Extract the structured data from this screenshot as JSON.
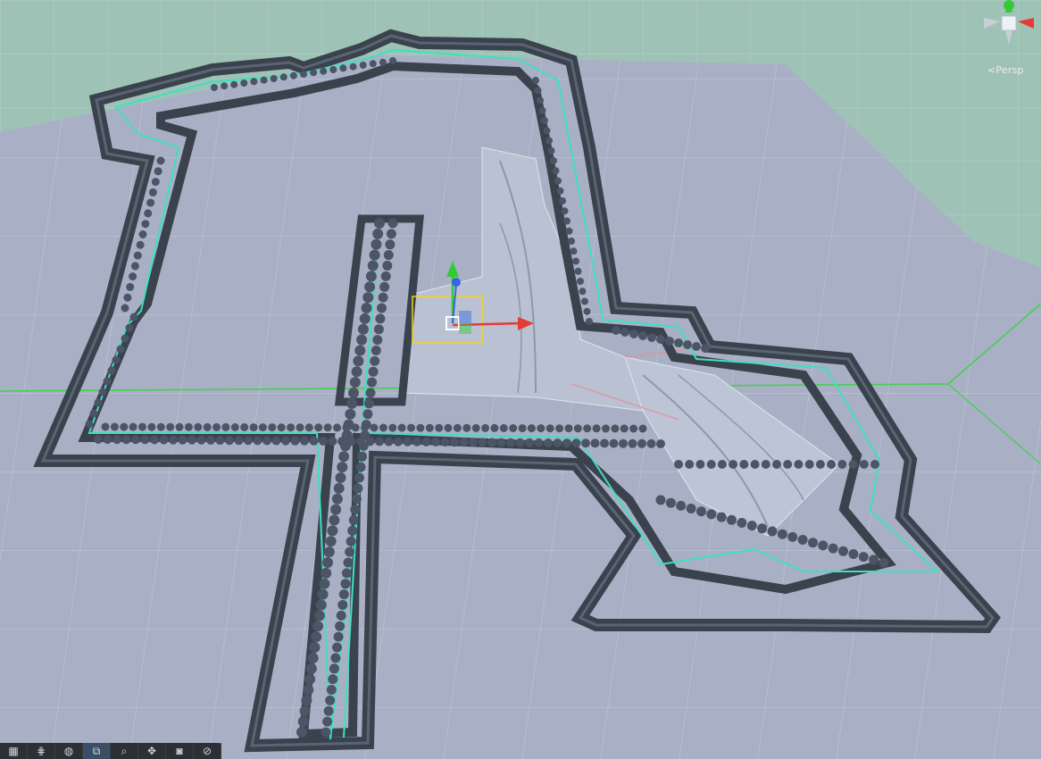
{
  "scene": {
    "view_mode_label": "Persp",
    "colors": {
      "ground_far": "#9fc2b6",
      "floor": "#a9b0c5",
      "wall": "#3f4855",
      "spline": "#3ee0c0",
      "x_axis": "#e53b35",
      "y_axis": "#35c93a",
      "z_axis": "#3667e0",
      "selection": "#f2d220"
    }
  },
  "gizmo": {
    "axes": [
      "x",
      "y",
      "z"
    ],
    "icon": "orientation-gizmo-icon"
  },
  "toolbar": {
    "items": [
      {
        "icon": "grid-icon",
        "symbol": "▦"
      },
      {
        "icon": "grid-snap-icon",
        "symbol": "⋕"
      },
      {
        "icon": "globe-icon",
        "symbol": "◍"
      },
      {
        "icon": "layers-icon",
        "symbol": "⧉"
      },
      {
        "icon": "search-icon",
        "symbol": "⌕"
      },
      {
        "icon": "move-icon",
        "symbol": "✥"
      },
      {
        "icon": "camera-icon",
        "symbol": "◙"
      },
      {
        "icon": "compass-icon",
        "symbol": "⊘"
      }
    ]
  }
}
